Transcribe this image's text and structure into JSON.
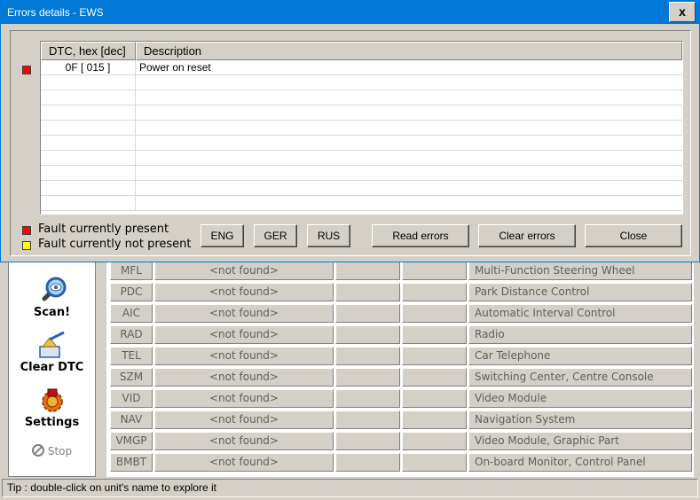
{
  "main": {
    "left_panel": {
      "scan_label": "Scan!",
      "clear_label": "Clear DTC",
      "settings_label": "Settings",
      "stop_label": "Stop"
    },
    "units": [
      {
        "code": "MFL",
        "status": "<not found>",
        "desc": "Multi-Function Steering Wheel"
      },
      {
        "code": "PDC",
        "status": "<not found>",
        "desc": "Park Distance Control"
      },
      {
        "code": "AIC",
        "status": "<not found>",
        "desc": "Automatic Interval Control"
      },
      {
        "code": "RAD",
        "status": "<not found>",
        "desc": "Radio"
      },
      {
        "code": "TEL",
        "status": "<not found>",
        "desc": "Car Telephone"
      },
      {
        "code": "SZM",
        "status": "<not found>",
        "desc": "Switching Center, Centre Console"
      },
      {
        "code": "VID",
        "status": "<not found>",
        "desc": "Video Module"
      },
      {
        "code": "NAV",
        "status": "<not found>",
        "desc": "Navigation System"
      },
      {
        "code": "VMGP",
        "status": "<not found>",
        "desc": "Video Module, Graphic Part"
      },
      {
        "code": "BMBT",
        "status": "<not found>",
        "desc": "On-board Monitor, Control Panel"
      }
    ],
    "status_tip": "Tip : double-click on unit's name to explore it"
  },
  "dialog": {
    "title": "Errors details - EWS",
    "close_glyph": "x",
    "grid": {
      "col_dtc": "DTC, hex [dec]",
      "col_desc": "Description",
      "rows": [
        {
          "dtc": "0F [ 015 ]",
          "desc": "Power on reset"
        }
      ]
    },
    "legend": {
      "present": "Fault currently present",
      "not_present": "Fault currently not present"
    },
    "buttons": {
      "eng": "ENG",
      "ger": "GER",
      "rus": "RUS",
      "read": "Read errors",
      "clear": "Clear errors",
      "close": "Close"
    },
    "colors": {
      "titlebar": "#0078d7",
      "present": "#ff0000",
      "not_present": "#ffff00"
    }
  }
}
